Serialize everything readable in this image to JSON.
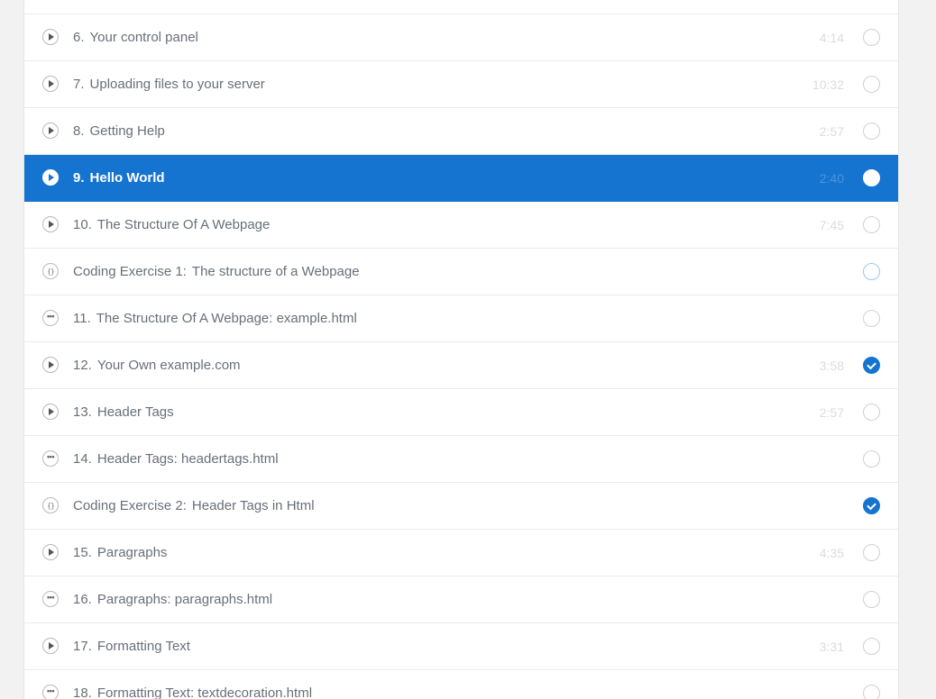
{
  "lectures": [
    {
      "kind": "video",
      "icon": "play-icon",
      "num": "6.",
      "title": "Your control panel",
      "duration": "4:14",
      "state": "empty",
      "active": false
    },
    {
      "kind": "video",
      "icon": "play-icon",
      "num": "7.",
      "title": "Uploading files to your server",
      "duration": "10:32",
      "state": "empty",
      "active": false
    },
    {
      "kind": "video",
      "icon": "play-icon",
      "num": "8.",
      "title": "Getting Help",
      "duration": "2:57",
      "state": "empty",
      "active": false
    },
    {
      "kind": "video",
      "icon": "play-icon",
      "num": "9.",
      "title": "Hello World",
      "duration": "2:40",
      "state": "empty",
      "active": true
    },
    {
      "kind": "video",
      "icon": "play-icon",
      "num": "10.",
      "title": "The Structure Of A Webpage",
      "duration": "7:45",
      "state": "empty",
      "active": false
    },
    {
      "kind": "exercise",
      "icon": "code-braces-icon",
      "num": "Coding Exercise 1:",
      "title": "The structure of a Webpage",
      "duration": "",
      "state": "exercise",
      "active": false
    },
    {
      "kind": "article",
      "icon": "ellipsis-icon",
      "num": "11.",
      "title": "The Structure Of A Webpage: example.html",
      "duration": "",
      "state": "empty",
      "active": false
    },
    {
      "kind": "video",
      "icon": "play-icon",
      "num": "12.",
      "title": "Your Own example.com",
      "duration": "3:58",
      "state": "done",
      "active": false
    },
    {
      "kind": "video",
      "icon": "play-icon",
      "num": "13.",
      "title": "Header Tags",
      "duration": "2:57",
      "state": "empty",
      "active": false
    },
    {
      "kind": "article",
      "icon": "ellipsis-icon",
      "num": "14.",
      "title": "Header Tags: headertags.html",
      "duration": "",
      "state": "empty",
      "active": false
    },
    {
      "kind": "exercise",
      "icon": "code-braces-icon",
      "num": "Coding Exercise 2:",
      "title": "Header Tags in Html",
      "duration": "",
      "state": "done",
      "active": false
    },
    {
      "kind": "video",
      "icon": "play-icon",
      "num": "15.",
      "title": "Paragraphs",
      "duration": "4:35",
      "state": "empty",
      "active": false
    },
    {
      "kind": "article",
      "icon": "ellipsis-icon",
      "num": "16.",
      "title": "Paragraphs: paragraphs.html",
      "duration": "",
      "state": "empty",
      "active": false
    },
    {
      "kind": "video",
      "icon": "play-icon",
      "num": "17.",
      "title": "Formatting Text",
      "duration": "3:31",
      "state": "empty",
      "active": false
    },
    {
      "kind": "article",
      "icon": "ellipsis-icon",
      "num": "18.",
      "title": "Formatting Text: textdecoration.html",
      "duration": "",
      "state": "empty",
      "active": false
    }
  ],
  "colors": {
    "accent": "#1674d1",
    "text": "#686f7a",
    "duration": "#dcdcdc",
    "background": "#f2f2f2"
  }
}
